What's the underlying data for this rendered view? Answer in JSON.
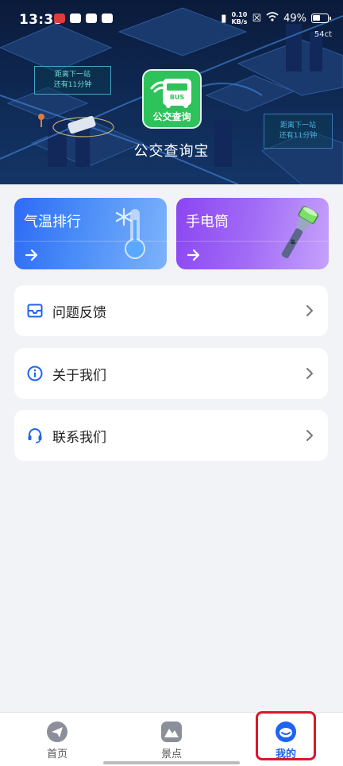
{
  "status_bar": {
    "time": "13:35",
    "net_speed_value": "0.10",
    "net_speed_unit": "KB/s",
    "battery": "49%",
    "sub_label": "54ct"
  },
  "hero": {
    "callout_left_line1": "距离下一站",
    "callout_left_line2": "还有11分钟",
    "callout_right_line1": "距离下一站",
    "callout_right_line2": "还有11分钟",
    "logo_text": "公交查询",
    "logo_bus_text": "BUS",
    "app_name": "公交查询宝"
  },
  "cards": {
    "temperature_label": "气温排行",
    "flashlight_label": "手电筒"
  },
  "menu": {
    "feedback_label": "问题反馈",
    "about_label": "关于我们",
    "contact_label": "联系我们"
  },
  "tabbar": {
    "home_label": "首页",
    "scenic_label": "景点",
    "mine_label": "我的",
    "active_tab": "我的"
  },
  "colors": {
    "accent": "#1f64f0",
    "temperature_card": "#2d6bf5",
    "flashlight_card": "#8b46f1",
    "logo_green": "#2ec35a",
    "highlight_red": "#d8182a"
  }
}
